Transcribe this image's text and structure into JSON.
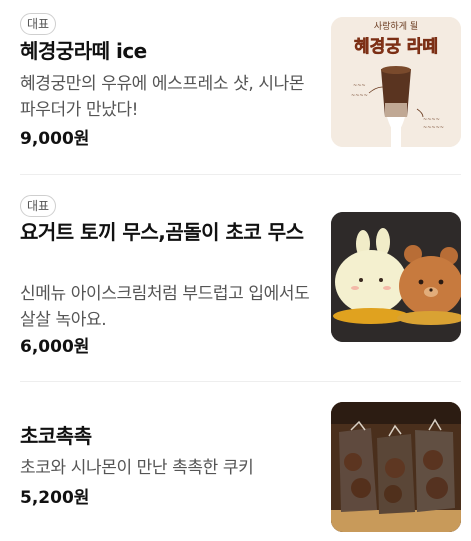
{
  "menu": {
    "items": [
      {
        "badge": "대표",
        "title": "혜경궁라떼 ice",
        "description": "혜경궁만의 우유에 에스프레소 샷, 시나몬 파우더가 만났다!",
        "price": "9,000원",
        "image_text_top": "사랑하게 될",
        "image_text_main": "혜경궁 라떼"
      },
      {
        "badge": "대표",
        "title": "요거트 토끼 무스,곰돌이 초코 무스",
        "description": "신메뉴 아이스크림처럼 부드럽고 입에서도 살살 녹아요.",
        "price": "6,000원"
      },
      {
        "title": "초코촉촉",
        "description": "초코와 시나몬이 만난 촉촉한 쿠키",
        "price": "5,200원"
      }
    ]
  }
}
